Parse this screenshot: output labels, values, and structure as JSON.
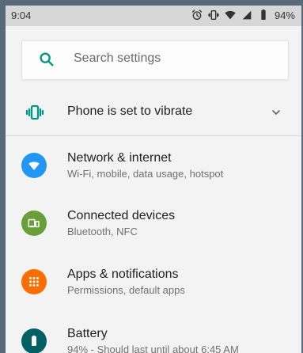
{
  "status_bar": {
    "time": "9:04",
    "battery_percent": "94%",
    "icons": [
      "alarm-icon",
      "vibrate-icon",
      "wifi-icon",
      "signal-icon",
      "battery-icon"
    ]
  },
  "search": {
    "placeholder": "Search settings"
  },
  "sound_mode": {
    "label": "Phone is set to vibrate"
  },
  "settings": [
    {
      "title": "Network & internet",
      "subtitle": "Wi-Fi, mobile, data usage, hotspot",
      "color": "#2196f3",
      "icon": "wifi-icon"
    },
    {
      "title": "Connected devices",
      "subtitle": "Bluetooth, NFC",
      "color": "#689f38",
      "icon": "devices-icon"
    },
    {
      "title": "Apps & notifications",
      "subtitle": "Permissions, default apps",
      "color": "#ff6d00",
      "icon": "apps-icon"
    },
    {
      "title": "Battery",
      "subtitle": "94% - Should last until about 6:45 AM",
      "color": "#006064",
      "icon": "battery-icon"
    }
  ]
}
